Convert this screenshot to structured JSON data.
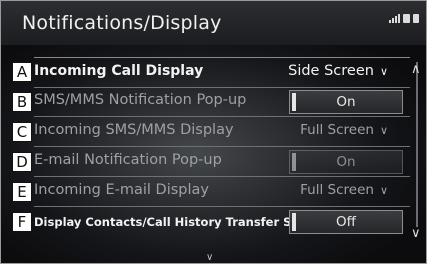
{
  "header": {
    "title": "Notifications/Display"
  },
  "rows": [
    {
      "tag": "A",
      "label": "Incoming Call Display",
      "value": "Side Screen"
    },
    {
      "tag": "B",
      "label": "SMS/MMS Notification Pop-up",
      "value": "On"
    },
    {
      "tag": "C",
      "label": "Incoming SMS/MMS Display",
      "value": "Full Screen"
    },
    {
      "tag": "D",
      "label": "E-mail Notification Pop-up",
      "value": "On"
    },
    {
      "tag": "E",
      "label": "Incoming E-mail Display",
      "value": "Full Screen"
    },
    {
      "tag": "F",
      "label": "Display Contacts/Call History Transfer Status",
      "value": "Off"
    }
  ],
  "icons": {
    "chevron": "chevron-down-icon",
    "scroll_up": "scroll-up-icon",
    "scroll_down": "scroll-down-icon",
    "more": "more-below-icon"
  }
}
